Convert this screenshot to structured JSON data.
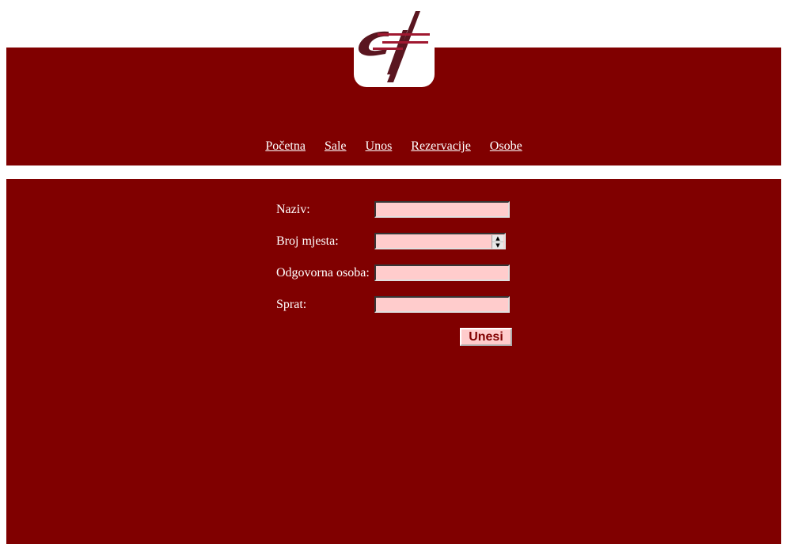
{
  "nav": {
    "items": [
      {
        "label": "Početna"
      },
      {
        "label": "Sale"
      },
      {
        "label": "Unos"
      },
      {
        "label": "Rezervacije"
      },
      {
        "label": "Osobe"
      }
    ]
  },
  "form": {
    "fields": [
      {
        "label": "Naziv:",
        "value": ""
      },
      {
        "label": "Broj mjesta:",
        "value": ""
      },
      {
        "label": "Odgovorna osoba:",
        "value": ""
      },
      {
        "label": "Sprat:",
        "value": ""
      }
    ],
    "submit_label": "Unesi"
  },
  "colors": {
    "brand": "#800000",
    "field_bg": "#ffcccc",
    "page_bg": "#ffffff"
  },
  "icons": {
    "logo": "etf-logo",
    "spinner": "number-spinner-icon"
  }
}
